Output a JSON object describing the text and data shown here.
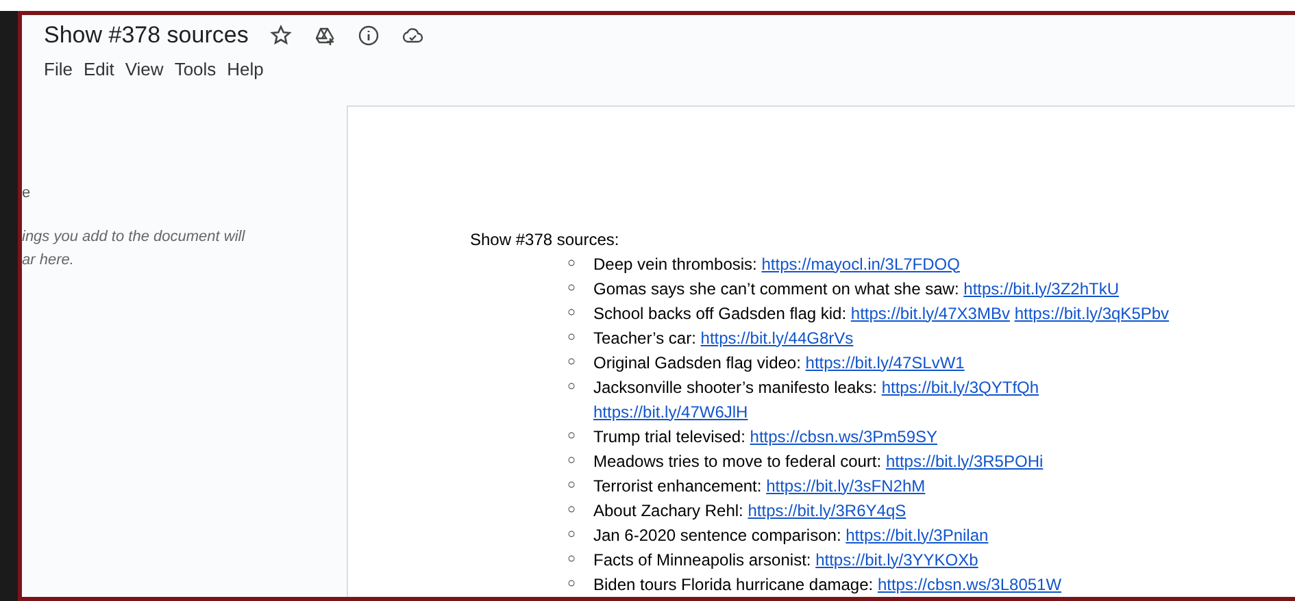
{
  "document": {
    "title": "Show #378 sources"
  },
  "menu": [
    "File",
    "Edit",
    "View",
    "Tools",
    "Help"
  ],
  "outline": {
    "heading": "e",
    "hint_lines": [
      "ings you add to the document will",
      "ar here."
    ]
  },
  "page": {
    "heading": "Show #378 sources:",
    "items": [
      {
        "marker": "○",
        "text": "Deep vein thrombosis:",
        "links": [
          "https://mayocl.in/3L7FDOQ"
        ]
      },
      {
        "marker": "○",
        "text": "Gomas says she can’t comment on what she saw:",
        "links": [
          "https://bit.ly/3Z2hTkU"
        ]
      },
      {
        "marker": "○",
        "text": "School backs off Gadsden flag kid:",
        "links": [
          "https://bit.ly/47X3MBv",
          "https://bit.ly/3qK5Pbv"
        ]
      },
      {
        "marker": "○",
        "text": "Teacher’s car:",
        "links": [
          "https://bit.ly/44G8rVs"
        ]
      },
      {
        "marker": "○",
        "text": "Original Gadsden flag video:",
        "links": [
          "https://bit.ly/47SLvW1"
        ]
      },
      {
        "marker": "○",
        "text": "Jacksonville shooter’s manifesto leaks:",
        "links": [
          "https://bit.ly/3QYTfQh"
        ],
        "wrapped_links": [
          "https://bit.ly/47W6JlH"
        ]
      },
      {
        "marker": "○",
        "text": "Trump trial televised:",
        "links": [
          "https://cbsn.ws/3Pm59SY"
        ]
      },
      {
        "marker": "○",
        "text": "Meadows tries to move to federal court:",
        "links": [
          "https://bit.ly/3R5POHi"
        ]
      },
      {
        "marker": "○",
        "text": "Terrorist enhancement:",
        "links": [
          "https://bit.ly/3sFN2hM"
        ]
      },
      {
        "marker": "○",
        "text": "About Zachary Rehl:",
        "links": [
          "https://bit.ly/3R6Y4qS"
        ]
      },
      {
        "marker": "○",
        "text": "Jan 6-2020 sentence comparison:",
        "links": [
          "https://bit.ly/3Pnilan"
        ]
      },
      {
        "marker": "○",
        "text": "Facts of Minneapolis arsonist:",
        "links": [
          "https://bit.ly/3YYKOXb"
        ]
      },
      {
        "marker": "○",
        "text": "Biden tours Florida hurricane damage:",
        "links": [
          "https://cbsn.ws/3L8051W"
        ]
      }
    ]
  }
}
